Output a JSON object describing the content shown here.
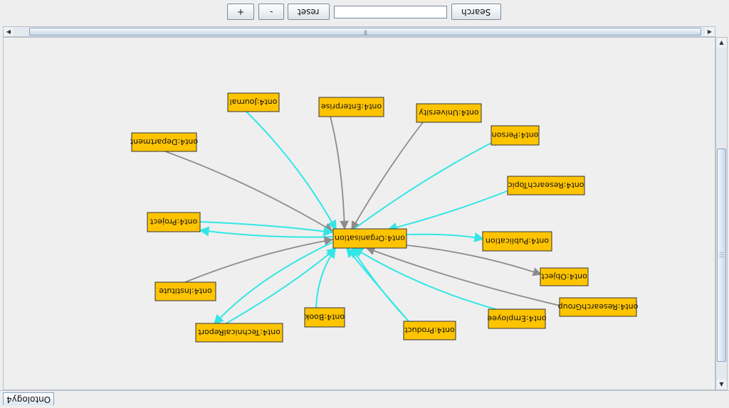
{
  "toolbar": {
    "zoom_in_label": "+",
    "zoom_out_label": "-",
    "reset_label": "reset",
    "search_value": "",
    "search_label": "Search"
  },
  "tab": {
    "label": "Ontology4"
  },
  "colors": {
    "node_fill": "#ffc400",
    "node_border": "#333333",
    "edge_gray": "#8c8c8c",
    "edge_cyan": "#33e6e6"
  },
  "graph": {
    "center": "ont4:Organisation",
    "nodes": [
      "ont4:Organisation",
      "ont4:Journal",
      "ont4:Enterprise",
      "ont4:University",
      "ont4:Department",
      "ont4:Person",
      "ont4:ResearchTopic",
      "ont4:Project",
      "ont4:Publication",
      "ont4:Object",
      "ont4:Institute",
      "ont4:ResearchGroup",
      "ont4:Book",
      "ont4:Employee",
      "ont4:Product",
      "ont4:TechnicalReport"
    ]
  }
}
